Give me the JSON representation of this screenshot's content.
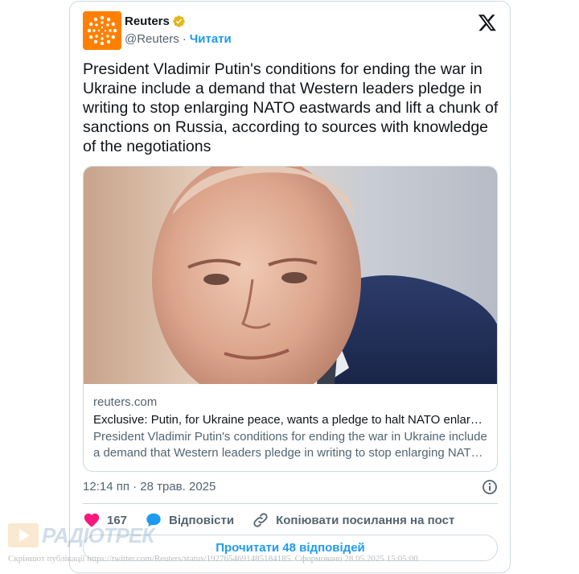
{
  "author": {
    "name": "Reuters",
    "handle": "@Reuters",
    "separator": "·",
    "follow_label": "Читати"
  },
  "tweet": {
    "text": "President Vladimir Putin's conditions for ending the war in Ukraine include a demand that Western leaders pledge in writing to stop enlarging NATO eastwards and lift a chunk of sanctions on Russia, according to sources with knowledge of the negotiations"
  },
  "link_card": {
    "domain": "reuters.com",
    "title": "Exclusive: Putin, for Ukraine peace, wants a pledge to halt NATO enlargement",
    "description": "President Vladimir Putin's conditions for ending the war in Ukraine include a demand that Western leaders pledge in writing to stop enlarging NATO eastwards"
  },
  "timestamp": "12:14 пп · 28 трав. 2025",
  "actions": {
    "likes_count": "167",
    "reply_label": "Відповісти",
    "copy_link_label": "Копіювати посилання на пост"
  },
  "read_replies_label": "Прочитати 48 відповідей",
  "watermark": {
    "brand": "РАДІОТРЕК"
  },
  "footnote": "Скріншот публікації https://twitter.com/Reuters/status/1927654691485184185. Сформовано 28.05.2025 15:05:00",
  "icons": {
    "verified": "verified-badge-icon",
    "x_logo": "x-logo-icon",
    "info": "info-icon",
    "heart": "heart-icon",
    "reply": "reply-bubble-icon",
    "link": "link-icon"
  },
  "colors": {
    "accent": "#1d9bf0",
    "reuters_orange": "#ff8000",
    "heart": "#f91880",
    "verified_gold": "#e2b719",
    "secondary_text": "#536471"
  }
}
